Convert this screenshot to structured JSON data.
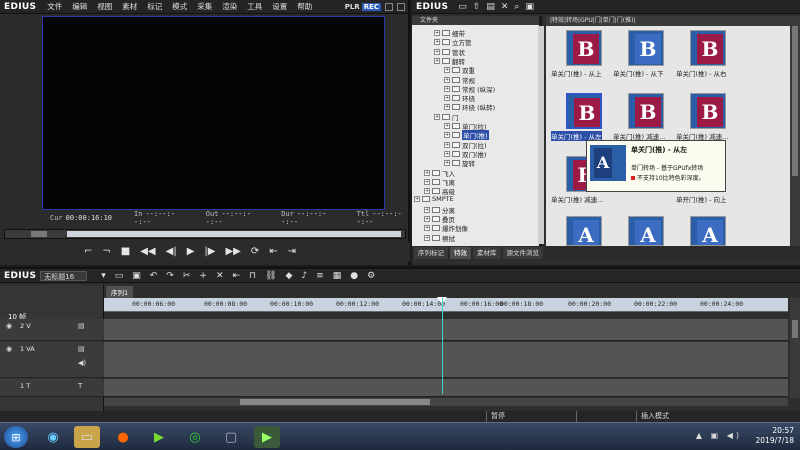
{
  "app": {
    "logo": "EDIUS",
    "menu": [
      "文件",
      "编辑",
      "视图",
      "素材",
      "标记",
      "模式",
      "采集",
      "渲染",
      "工具",
      "设置",
      "帮助"
    ],
    "plr_label": "PLR",
    "rec_label": "REC"
  },
  "player": {
    "timecodes": [
      {
        "label": "Cur",
        "value": "00:00:16:10"
      },
      {
        "label": "In",
        "value": "--:--:--:--"
      },
      {
        "label": "Out",
        "value": "--:--:--:--"
      },
      {
        "label": "Dur",
        "value": "--:--:--:--"
      },
      {
        "label": "Ttl",
        "value": "--:--:--:--"
      }
    ],
    "transport_icons": [
      "set-in-icon",
      "set-out-icon",
      "stop-icon",
      "rewind-icon",
      "step-back-icon",
      "play-icon",
      "step-forward-icon",
      "fast-forward-icon",
      "loop-icon",
      "insert-icon",
      "overwrite-icon"
    ]
  },
  "library": {
    "logo": "EDIUS",
    "tree_header": "文件夹",
    "bin_path": "|特效|转场|GPU|门|单门|门(推)|",
    "tree_items": [
      {
        "label": "细带",
        "indent": 3
      },
      {
        "label": "立方管",
        "indent": 3
      },
      {
        "label": "管状",
        "indent": 3
      },
      {
        "label": "翻转",
        "indent": 3
      },
      {
        "label": "双重",
        "indent": 4
      },
      {
        "label": "常规",
        "indent": 4
      },
      {
        "label": "常规 (纵深)",
        "indent": 4
      },
      {
        "label": "环绕",
        "indent": 4
      },
      {
        "label": "环绕 (纵转)",
        "indent": 4
      },
      {
        "label": "门",
        "indent": 3
      },
      {
        "label": "单门(拉)",
        "indent": 4
      },
      {
        "label": "单门(推)",
        "indent": 4,
        "selected": true
      },
      {
        "label": "双门(拉)",
        "indent": 4
      },
      {
        "label": "双门(推)",
        "indent": 4
      },
      {
        "label": "旋转",
        "indent": 4
      },
      {
        "label": "飞入",
        "indent": 2
      },
      {
        "label": "飞离",
        "indent": 2
      },
      {
        "label": "高级",
        "indent": 2
      },
      {
        "label": "SMPTE",
        "indent": 1
      },
      {
        "label": "分离",
        "indent": 2
      },
      {
        "label": "叠页",
        "indent": 2
      },
      {
        "label": "爆炸划像",
        "indent": 2
      },
      {
        "label": "擦拭",
        "indent": 2
      }
    ],
    "thumb_labels": [
      "单关门(推) - 从上",
      "单关门(推) - 从下",
      "单关门(推) - 从右",
      "单关门(推) - 从左",
      "单关门(推) 减速...",
      "单关门(推) 减速...",
      "单关门(推) 减速...",
      "单开门(推) - 向上"
    ],
    "tabs": [
      "序列标记",
      "特效",
      "素材库",
      "源文件浏览"
    ],
    "active_tab": "特效",
    "tooltip": {
      "title": "单关门(推) - 从左",
      "line1": "单门转场 - 基于GPUfx转场",
      "line2": "不支持10比特色彩深度。"
    }
  },
  "timeline": {
    "logo": "EDIUS",
    "sequence_name": "无标题16",
    "sequence_tab": "序列1",
    "zoom_label": "10 帧",
    "ruler_ticks": [
      "00:00:06:00",
      "00:00:08:00",
      "00:00:10:00",
      "00:00:12:00",
      "00:00:14:00",
      "00:00:16:00",
      "00:00:18:00",
      "00:00:20:00",
      "00:00:22:00",
      "00:00:24:00"
    ],
    "tracks": [
      {
        "name": "2 V"
      },
      {
        "name": "1 VA"
      },
      {
        "name": "1 T"
      }
    ],
    "status": [
      "暂停",
      "插入模式"
    ]
  },
  "taskbar": {
    "time": "20:57",
    "date": "2019/7/18"
  }
}
